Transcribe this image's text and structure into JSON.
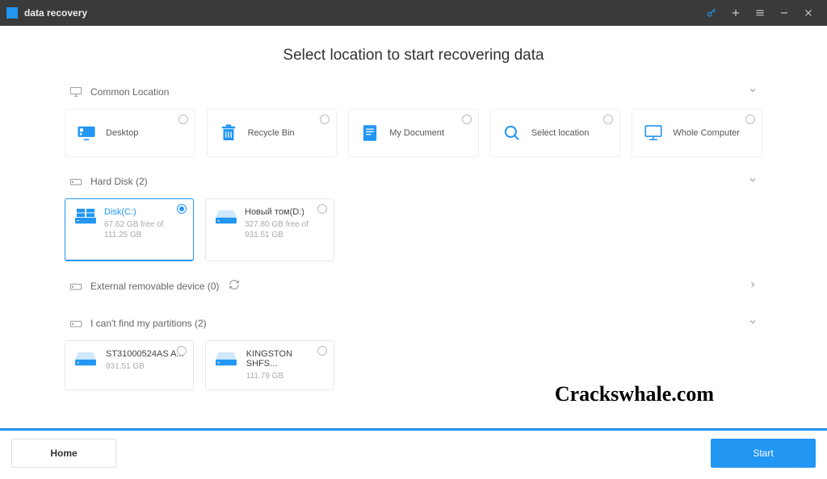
{
  "app": {
    "title": "data recovery"
  },
  "page": {
    "heading": "Select location to start recovering data"
  },
  "sections": {
    "common": {
      "label": "Common Location",
      "items": [
        {
          "label": "Desktop"
        },
        {
          "label": "Recycle Bin"
        },
        {
          "label": "My Document"
        },
        {
          "label": "Select location"
        },
        {
          "label": "Whole Computer"
        }
      ]
    },
    "harddisk": {
      "label": "Hard Disk (2)",
      "items": [
        {
          "name": "Disk(C:)",
          "sub": "67.62 GB  free of 111.25 GB",
          "selected": true
        },
        {
          "name": "Новый том(D:)",
          "sub": "327.80 GB  free of 931.51 GB",
          "selected": false
        }
      ]
    },
    "external": {
      "label": "External removable device (0)"
    },
    "lost": {
      "label": "I can't find my partitions (2)",
      "items": [
        {
          "name": "ST31000524AS A...",
          "sub": "931.51 GB"
        },
        {
          "name": "KINGSTON SHFS...",
          "sub": "111.79 GB"
        }
      ]
    }
  },
  "footer": {
    "home": "Home",
    "start": "Start"
  },
  "watermark": "Crackswhale.com"
}
